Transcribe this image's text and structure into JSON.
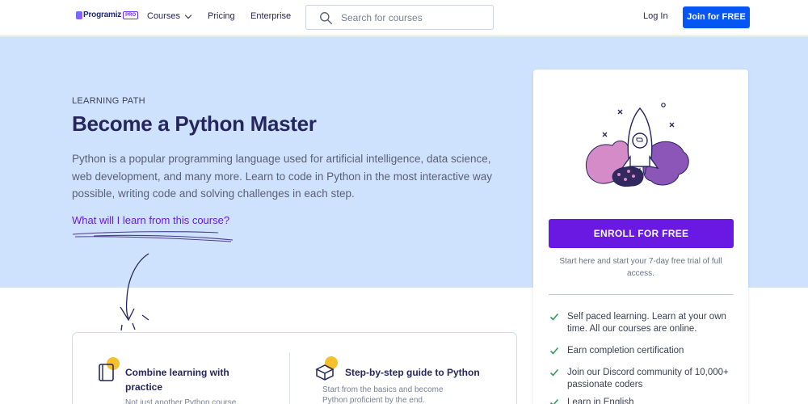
{
  "brand": {
    "name": "Programiz",
    "badge": "PRO",
    "accent": "#6a19e3",
    "primary_blue": "#0556f3",
    "hero_bg": "#cfe2fd"
  },
  "nav": {
    "courses": "Courses",
    "pricing": "Pricing",
    "enterprise": "Enterprise",
    "search_placeholder": "Search for courses",
    "login": "Log In",
    "join": "Join for FREE"
  },
  "hero": {
    "eyebrow": "LEARNING PATH",
    "title": "Become a Python Master",
    "description": "Python is a popular programming language used for artificial intelligence, data science, web development, and many more. Learn to code in Python in the most interactive way possible, writing code and solving challenges in each step.",
    "learn_link": "What will I learn from this course?"
  },
  "features": [
    {
      "icon": "book-icon",
      "title": "Combine learning with practice",
      "desc": "Not just another Python course"
    },
    {
      "icon": "cube-icon",
      "title": "Step-by-step guide to Python",
      "desc": "Start from the basics and become",
      "desc2": "Python proficient by the end."
    }
  ],
  "card": {
    "enroll": "ENROLL FOR FREE",
    "trial_note": "Start here and start your 7-day free trial of full access.",
    "benefits": [
      "Self paced learning. Learn at your own time. All our courses are online.",
      "Earn completion certification",
      "Join our Discord community of 10,000+ passionate coders",
      "Learn in English"
    ]
  }
}
